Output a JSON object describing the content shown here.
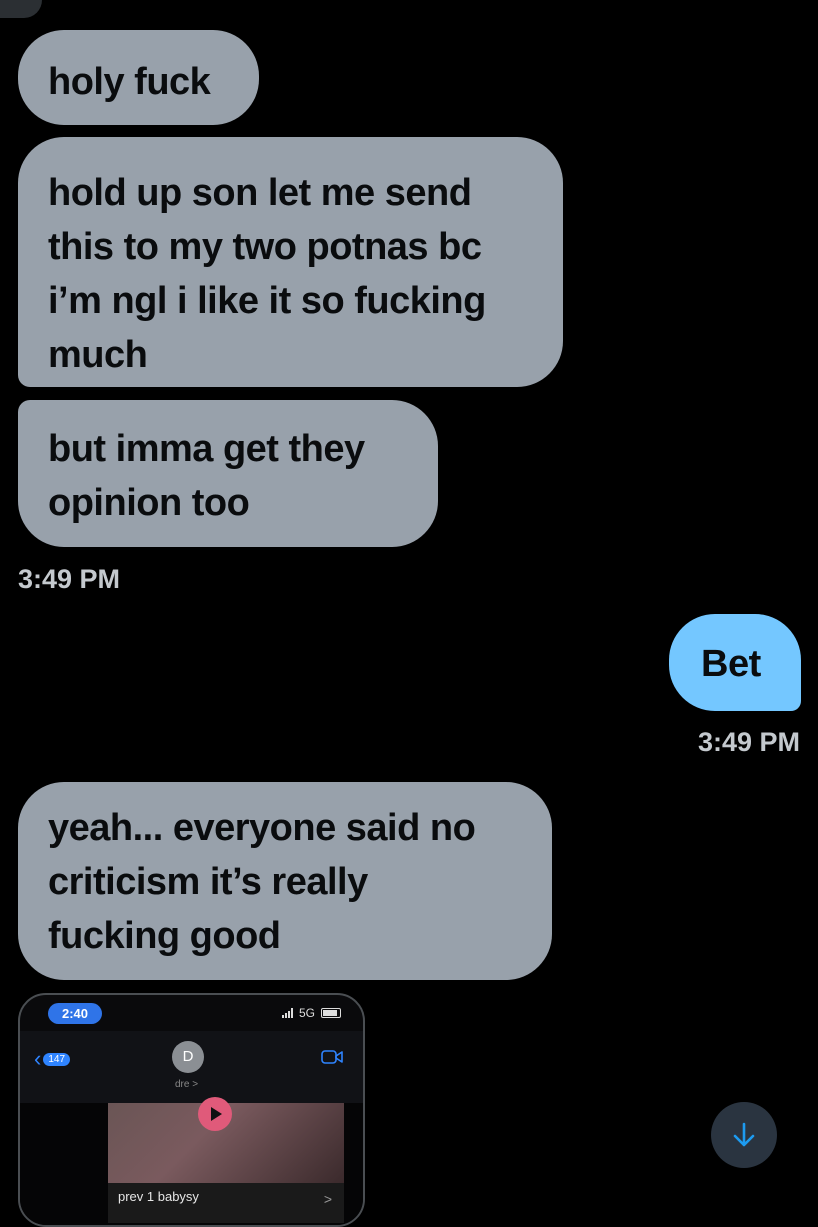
{
  "messages": [
    {
      "text": "holy fuck",
      "direction": "incoming"
    },
    {
      "lines": [
        "hold up son let me send",
        "this to my two potnas bc",
        "i’m ngl i like it so fucking",
        "much"
      ],
      "direction": "incoming"
    },
    {
      "lines": [
        "but imma get they",
        "opinion too"
      ],
      "direction": "incoming",
      "timestamp": "3:49 PM"
    },
    {
      "text": "Bet",
      "direction": "outgoing",
      "timestamp": "3:49 PM"
    },
    {
      "lines": [
        "yeah... everyone said no",
        "criticism it’s really",
        "fucking good"
      ],
      "direction": "incoming"
    }
  ],
  "attachment": {
    "status_time": "2:40",
    "network": "5G",
    "back_count": "147",
    "avatar_initial": "D",
    "contact_name": "dre",
    "contact_chevron": ">",
    "caption": "prev 1 babysy",
    "caption_chevron": ">"
  },
  "colors": {
    "background": "#000000",
    "incoming_bubble": "#98a1ab",
    "outgoing_bubble": "#74c7ff",
    "timestamp_text": "#c4c9ce",
    "scroll_button": "#2a3440",
    "accent": "#1d9bf0"
  },
  "icons": {
    "scroll_down": "arrow-down-icon",
    "video": "video-camera-icon",
    "back": "chevron-left-icon"
  }
}
